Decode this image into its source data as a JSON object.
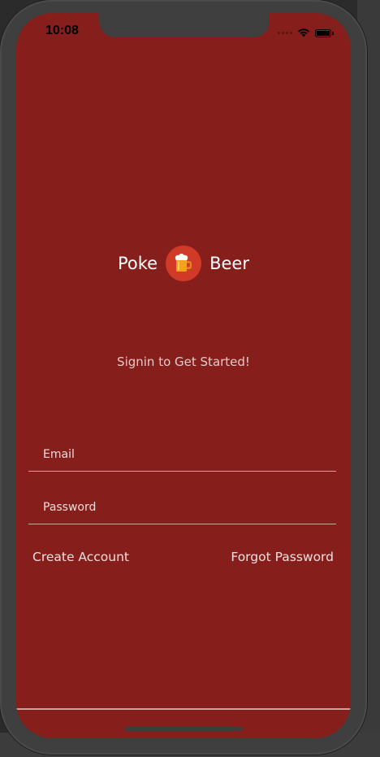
{
  "status_bar": {
    "time": "10:08",
    "icons": [
      "signal-dots-icon",
      "wifi-icon",
      "battery-icon"
    ]
  },
  "brand": {
    "word_left": "Poke",
    "word_right": "Beer",
    "logo_icon": "beer-mug-icon",
    "colors": {
      "background": "#861f1c",
      "logo_circle": "#d13a26"
    }
  },
  "tagline": "Signin to Get Started!",
  "form": {
    "email": {
      "placeholder": "Email",
      "value": ""
    },
    "password": {
      "placeholder": "Password",
      "value": ""
    }
  },
  "links": {
    "create_account": "Create Account",
    "forgot_password": "Forgot Password"
  }
}
